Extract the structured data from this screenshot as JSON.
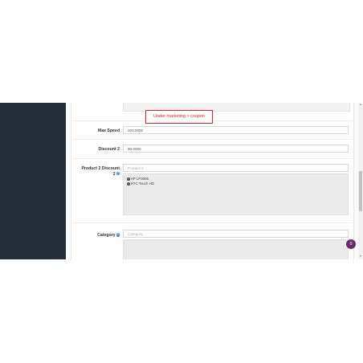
{
  "annotation": {
    "text": "Under marketing > coupon"
  },
  "form": {
    "max_speed": {
      "label": "Max Speed",
      "value": "200.0000"
    },
    "discount2": {
      "label": "Discount 2",
      "value": "90.0000"
    },
    "product2": {
      "label_line1": "Product 2 Discount",
      "label_line2": "2",
      "placeholder": "Product 2",
      "selected": [
        "HP LP3065",
        "HTC Touch HD"
      ]
    },
    "category": {
      "label": "Category",
      "placeholder": "Category"
    }
  },
  "help_icon": "?",
  "remove_icon": "−",
  "fab": {
    "label": "0",
    "color": "#6b2a6e"
  },
  "colors": {
    "sidebar": "#242d38",
    "callout": "#e52222",
    "help": "#3b8dd6"
  }
}
